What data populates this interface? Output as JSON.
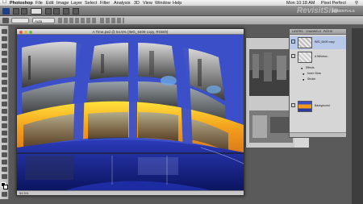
{
  "menubar": {
    "app_name": "Photoshop",
    "items": [
      "File",
      "Edit",
      "Image",
      "Layer",
      "Select",
      "Filter",
      "Analysis",
      "3D",
      "View",
      "Window",
      "Help"
    ],
    "clock": "Mon 10:18 AM",
    "user": "Pixel Perfect"
  },
  "appbar": {
    "workspace": "ESSENTIALS"
  },
  "optbar": {
    "mode_value": "Auto"
  },
  "document": {
    "title": "A Time.psd @ 54.5% (IMG_6409 copy, RGB/8)",
    "status": "54.5%"
  },
  "layers_panel": {
    "tabs": [
      "LAYERS",
      "CHANNELS",
      "PATHS"
    ],
    "layers": [
      {
        "name": "IMG_6409 copy"
      },
      {
        "name": "A Window..."
      },
      {
        "name": "Effects"
      },
      {
        "name": "Inner Glow"
      },
      {
        "name": "Stroke"
      },
      {
        "name": "Background"
      }
    ]
  },
  "watermark": "RevisitSite",
  "colors": {
    "frame_blue": "#3b4fc8",
    "frame_orange": "#f29a1a",
    "frame_yellow": "#ffe23a",
    "ui_gray": "#5a5a5a"
  }
}
